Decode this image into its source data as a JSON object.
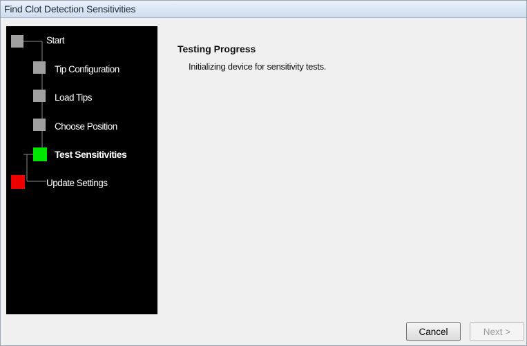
{
  "window": {
    "title": "Find Clot Detection Sensitivities"
  },
  "wizard": {
    "steps": [
      {
        "label": "Start",
        "status": "complete",
        "color": "#a0a0a0"
      },
      {
        "label": "Tip Configuration",
        "status": "complete",
        "color": "#a0a0a0"
      },
      {
        "label": "Load Tips",
        "status": "complete",
        "color": "#a0a0a0"
      },
      {
        "label": "Choose Position",
        "status": "complete",
        "color": "#a0a0a0"
      },
      {
        "label": "Test Sensitivities",
        "status": "current",
        "color": "#00e600"
      },
      {
        "label": "Update Settings",
        "status": "pending",
        "color": "#ee0000"
      }
    ]
  },
  "panel": {
    "heading": "Testing Progress",
    "message": "Initializing device for sensitivity tests."
  },
  "buttons": {
    "cancel": "Cancel",
    "next": "Next >",
    "next_enabled": false
  },
  "icons": {
    "step_marker": "square-step-icon",
    "tree_connector": "tree-line"
  }
}
